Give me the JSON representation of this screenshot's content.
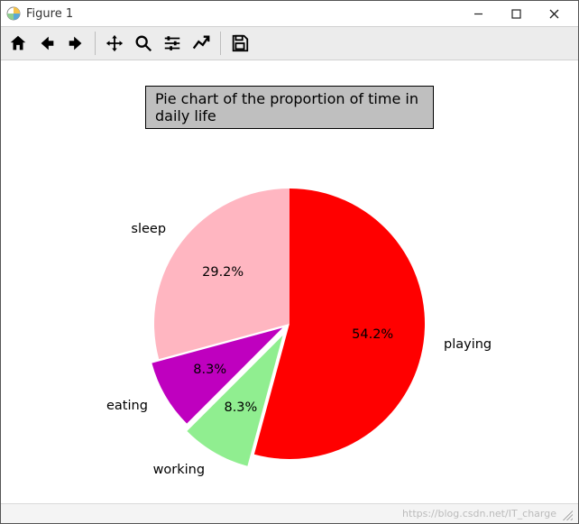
{
  "window": {
    "title": "Figure 1"
  },
  "winbuttons": {
    "minimize": "minimize",
    "maximize": "maximize",
    "close": "close"
  },
  "toolbar": {
    "home": "home",
    "back": "back",
    "forward": "forward",
    "pan": "pan",
    "zoom": "zoom",
    "subplots": "configure-subplots",
    "axes": "edit-axes",
    "save": "save"
  },
  "status": {
    "watermark": "https://blog.csdn.net/IT_charge"
  },
  "chart_data": {
    "type": "pie",
    "title": "Pie chart of the proportion of time in daily life",
    "start_angle_deg": 90,
    "direction": "clockwise",
    "slices": [
      {
        "label": "playing",
        "pct": 54.2,
        "pct_text": "54.2%",
        "color": "#ff0000",
        "explode": 0
      },
      {
        "label": "working",
        "pct": 8.3,
        "pct_text": "8.3%",
        "color": "#90ee90",
        "explode": 0.1
      },
      {
        "label": "eating",
        "pct": 8.3,
        "pct_text": "8.3%",
        "color": "#bf00bf",
        "explode": 0.06
      },
      {
        "label": "sleep",
        "pct": 29.2,
        "pct_text": "29.2%",
        "color": "#ffb6c1",
        "explode": 0
      }
    ]
  }
}
